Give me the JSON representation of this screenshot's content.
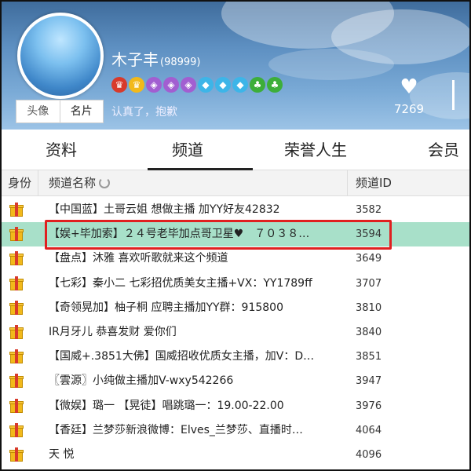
{
  "profile": {
    "name": "木子丰",
    "uid": "(98999)",
    "motto": "认真了，抱歉",
    "avatar_tabs": [
      "头像",
      "名片"
    ],
    "likes_count": "7269",
    "badges": [
      {
        "icon": "crown-red-icon",
        "color": "#d83a2b"
      },
      {
        "icon": "crown-gold-icon",
        "color": "#f2b91a"
      },
      {
        "icon": "purple-shield-icon",
        "color": "#a25ed1"
      },
      {
        "icon": "purple-shield-icon",
        "color": "#a25ed1"
      },
      {
        "icon": "purple-shield-icon",
        "color": "#a25ed1"
      },
      {
        "icon": "blue-diamond-icon",
        "color": "#3db5e8"
      },
      {
        "icon": "blue-diamond-icon",
        "color": "#3db5e8"
      },
      {
        "icon": "blue-diamond-icon",
        "color": "#3db5e8"
      },
      {
        "icon": "green-leaf-icon",
        "color": "#3dae3a"
      },
      {
        "icon": "green-leaf-icon",
        "color": "#3dae3a"
      }
    ]
  },
  "nav": {
    "tabs": [
      "资料",
      "频道",
      "荣誉人生",
      "会员"
    ],
    "active": "频道"
  },
  "table": {
    "headers": {
      "role": "身份",
      "name": "频道名称",
      "id": "频道ID"
    },
    "rows": [
      {
        "name": "【中国蓝】土哥云姐 想做主播 加YY好友42832",
        "id": "3582"
      },
      {
        "name": "【娱+毕加索】２４号老毕加点哥卫星♥　７０３８…",
        "id": "3594"
      },
      {
        "name": "【盘点】沐雅 喜欢听歌就来这个频道",
        "id": "3649"
      },
      {
        "name": "【七彩】秦小二 七彩招优质美女主播+VX：YY1789ff",
        "id": "3707"
      },
      {
        "name": "【奇领晃加】柚子桐 应聘主播加YY群：915800",
        "id": "3810"
      },
      {
        "name": "IR月牙儿 恭喜发财 爱你们",
        "id": "3840"
      },
      {
        "name": "【国威+.3851大佛】国威招收优质女主播，加V：D…",
        "id": "3851"
      },
      {
        "name": "〖雲源〗小纯做主播加V-wxy542266",
        "id": "3947"
      },
      {
        "name": "【微娱】璐一 【晃徒】唱跳璐一：19.00-22.00",
        "id": "3976"
      },
      {
        "name": "【香廷】兰梦莎新浪微博：Elves_兰梦莎、直播时…",
        "id": "4064"
      },
      {
        "name": "天 悦",
        "id": "4096"
      }
    ],
    "highlighted_index": 1
  }
}
